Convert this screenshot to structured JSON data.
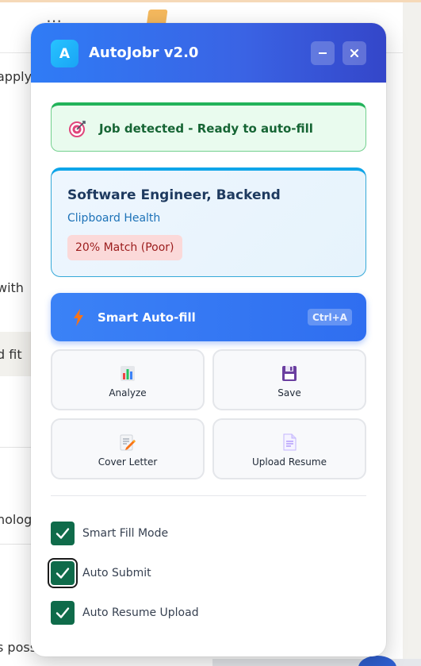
{
  "background": {
    "snippets": [
      "apply",
      "with",
      "d fit",
      "nolog",
      "s poss"
    ]
  },
  "popup": {
    "logo_letter": "A",
    "title": "AutoJobr v2.0",
    "minimize_label": "–",
    "close_label": "×",
    "status": {
      "text": "Job detected - Ready to auto-fill",
      "icon": "target-icon",
      "color": "#22b35a"
    },
    "job": {
      "title": "Software Engineer, Backend",
      "company": "Clipboard Health",
      "match": "20% Match (Poor)"
    },
    "autofill": {
      "label": "Smart Auto-fill",
      "shortcut": "Ctrl+A",
      "icon": "lightning-icon"
    },
    "actions": [
      {
        "label": "Analyze",
        "icon": "bar-chart-icon"
      },
      {
        "label": "Save",
        "icon": "floppy-disk-icon"
      },
      {
        "label": "Cover Letter",
        "icon": "memo-pencil-icon"
      },
      {
        "label": "Upload Resume",
        "icon": "document-icon"
      }
    ],
    "options": [
      {
        "label": "Smart Fill Mode",
        "checked": true
      },
      {
        "label": "Auto Submit",
        "checked": true
      },
      {
        "label": "Auto Resume Upload",
        "checked": true
      }
    ]
  },
  "colors": {
    "header_start": "#2f7cf6",
    "header_end": "#3446c9",
    "status_bg": "#e9fbee",
    "match_bg": "#fbd9d9",
    "checkbox": "#0f6b4a"
  }
}
